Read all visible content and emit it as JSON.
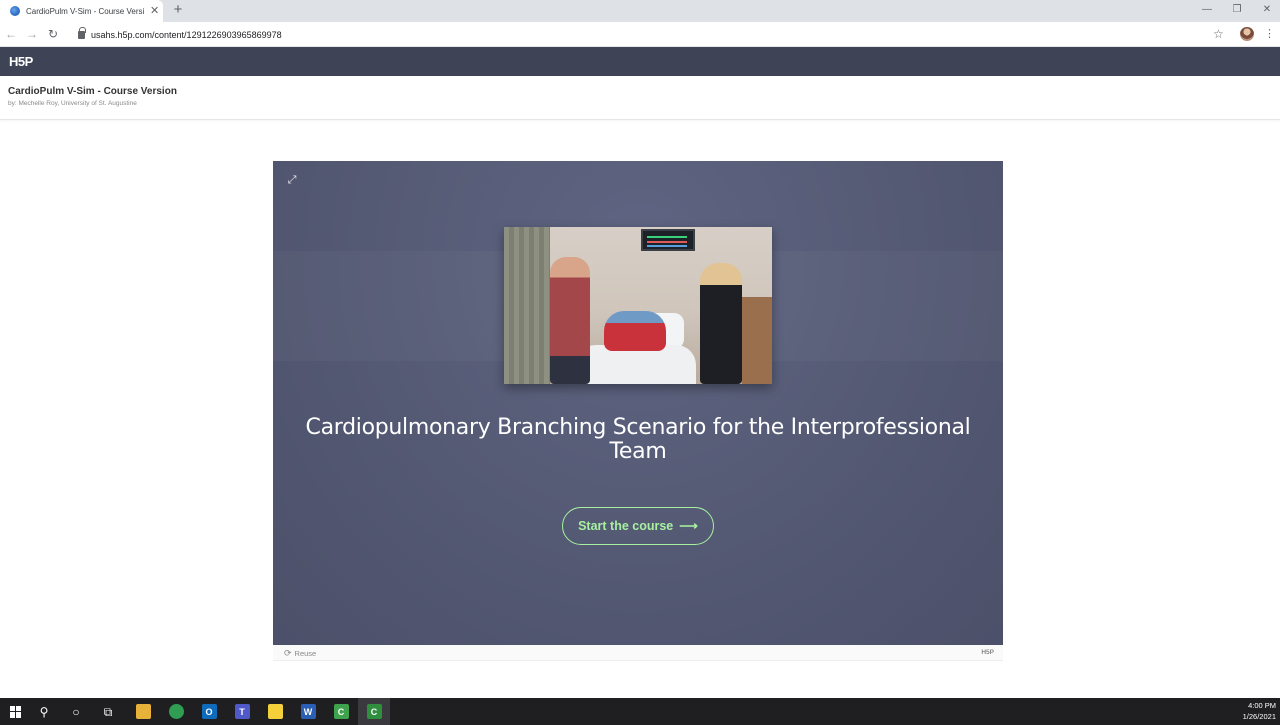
{
  "browser": {
    "tab_title": "CardioPulm V-Sim - Course Versi",
    "tab_close": "✕",
    "new_tab": "+",
    "url": "usahs.h5p.com/content/1291226903965869978",
    "window_controls": [
      "—",
      "❐",
      "✕"
    ]
  },
  "h5p_header": {
    "logo": "H5P"
  },
  "content": {
    "title": "CardioPulm V-Sim - Course Version",
    "byline": "by: Mechelle Roy, University of St. Augustine"
  },
  "stage": {
    "heading": "Cardiopulmonary Branching Scenario for the Interprofessional Team",
    "start_label": "Start the course",
    "start_arrow": "⟶"
  },
  "footer": {
    "reuse_label": "Reuse",
    "logo": "H5P"
  },
  "taskbar": {
    "apps": [
      {
        "name": "file-explorer",
        "color": "#e8b23a",
        "glyph": ""
      },
      {
        "name": "chrome",
        "color": "#2f9e52",
        "glyph": ""
      },
      {
        "name": "outlook",
        "color": "#0f6cbd",
        "glyph": "O"
      },
      {
        "name": "teams",
        "color": "#5059c9",
        "glyph": "T"
      },
      {
        "name": "sticky-notes",
        "color": "#f4d13a",
        "glyph": ""
      },
      {
        "name": "word",
        "color": "#2b5fb3",
        "glyph": "W"
      },
      {
        "name": "camtasia",
        "color": "#3fa34d",
        "glyph": "C"
      },
      {
        "name": "camtasia-recorder",
        "color": "#2f8f3f",
        "glyph": "C"
      }
    ],
    "time": "4:00 PM",
    "date": "1/26/2021"
  },
  "colors": {
    "h5p_bar": "#3e4456",
    "stage_bg": "#565b76",
    "accent_green": "#a6f0a0",
    "taskbar": "#1f1f22"
  }
}
